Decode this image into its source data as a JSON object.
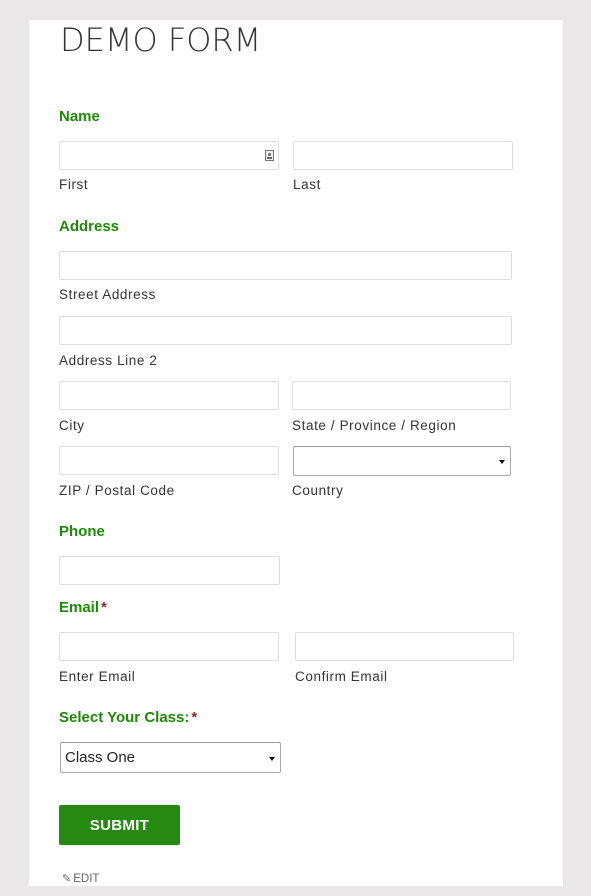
{
  "page": {
    "title": "DEMO FORM"
  },
  "colors": {
    "accent": "#1e8a08",
    "button": "#278a10",
    "required": "#8b2a2a",
    "background": "#e9e7e8"
  },
  "sections": {
    "name": {
      "label": "Name",
      "first": {
        "sub_label": "First",
        "value": ""
      },
      "last": {
        "sub_label": "Last",
        "value": ""
      }
    },
    "address": {
      "label": "Address",
      "street": {
        "sub_label": "Street Address",
        "value": ""
      },
      "line2": {
        "sub_label": "Address Line 2",
        "value": ""
      },
      "city": {
        "sub_label": "City",
        "value": ""
      },
      "state": {
        "sub_label": "State / Province / Region",
        "value": ""
      },
      "zip": {
        "sub_label": "ZIP / Postal Code",
        "value": ""
      },
      "country": {
        "sub_label": "Country",
        "selected": ""
      }
    },
    "phone": {
      "label": "Phone",
      "value": ""
    },
    "email": {
      "label": "Email",
      "required_mark": "*",
      "enter": {
        "sub_label": "Enter Email",
        "value": ""
      },
      "confirm": {
        "sub_label": "Confirm Email",
        "value": ""
      }
    },
    "class": {
      "label": "Select Your Class:",
      "required_mark": "*",
      "selected": "Class One"
    }
  },
  "actions": {
    "submit_label": "SUBMIT",
    "edit_label": "EDIT",
    "edit_icon": "pencil-icon"
  }
}
